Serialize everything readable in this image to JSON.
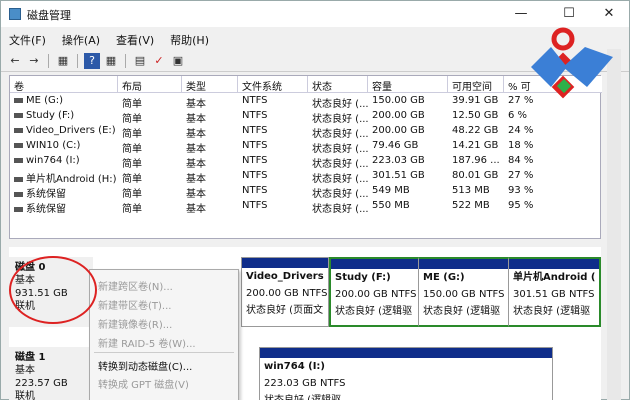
{
  "window": {
    "title": "磁盘管理",
    "buttons": [
      "—",
      "☐",
      "✕"
    ]
  },
  "menu": [
    "文件(F)",
    "操作(A)",
    "查看(V)",
    "帮助(H)"
  ],
  "toolbar": [
    "←",
    "→",
    "▦",
    "?",
    "▦",
    "▤",
    "✓",
    "▣"
  ],
  "table": {
    "columns": [
      "卷",
      "布局",
      "类型",
      "文件系统",
      "状态",
      "容量",
      "可用空间",
      "% 可"
    ],
    "rows": [
      [
        "ME (G:)",
        "简单",
        "基本",
        "NTFS",
        "状态良好 (...",
        "150.00 GB",
        "39.91 GB",
        "27 %"
      ],
      [
        "Study (F:)",
        "简单",
        "基本",
        "NTFS",
        "状态良好 (...",
        "200.00 GB",
        "12.50 GB",
        "6 %"
      ],
      [
        "Video_Drivers (E:)",
        "简单",
        "基本",
        "NTFS",
        "状态良好 (...",
        "200.00 GB",
        "48.22 GB",
        "24 %"
      ],
      [
        "WIN10 (C:)",
        "简单",
        "基本",
        "NTFS",
        "状态良好 (...",
        "79.46 GB",
        "14.21 GB",
        "18 %"
      ],
      [
        "win764 (I:)",
        "简单",
        "基本",
        "NTFS",
        "状态良好 (...",
        "223.03 GB",
        "187.96 ...",
        "84 %"
      ],
      [
        "单片机Android (H:)",
        "简单",
        "基本",
        "NTFS",
        "状态良好 (...",
        "301.51 GB",
        "80.01 GB",
        "27 %"
      ],
      [
        "系统保留",
        "简单",
        "基本",
        "NTFS",
        "状态良好 (...",
        "549 MB",
        "513 MB",
        "93 %"
      ],
      [
        "系统保留",
        "简单",
        "基本",
        "NTFS",
        "状态良好 (...",
        "550 MB",
        "522 MB",
        "95 %"
      ]
    ]
  },
  "disks": [
    {
      "name": "磁盘 0",
      "type": "基本",
      "size": "931.51 GB",
      "status": "联机"
    },
    {
      "name": "磁盘 1",
      "type": "基本",
      "size": "223.57 GB",
      "status": "联机"
    }
  ],
  "partitions": {
    "video": {
      "name": "Video_Drivers (",
      "size": "200.00 GB NTFS",
      "status": "状态良好 (页面文"
    },
    "study": {
      "name": "Study  (F:)",
      "size": "200.00 GB NTFS",
      "status": "状态良好 (逻辑驱"
    },
    "me": {
      "name": "ME  (G:)",
      "size": "150.00 GB NTFS",
      "status": "状态良好 (逻辑驱"
    },
    "android": {
      "name": "单片机Android (",
      "size": "301.51 GB NTFS",
      "status": "状态良好 (逻辑驱"
    },
    "win764": {
      "name": "win764  (I:)",
      "size": "223.03 GB NTFS",
      "status": "状态良好 (逻辑驱"
    }
  },
  "context_menu": {
    "items": [
      {
        "label": "新建跨区卷(N)...",
        "enabled": false
      },
      {
        "label": "新建带区卷(T)...",
        "enabled": false
      },
      {
        "label": "新建镜像卷(R)...",
        "enabled": false
      },
      {
        "label": "新建 RAID-5 卷(W)...",
        "enabled": false
      },
      {
        "label": "转换到动态磁盘(C)...",
        "enabled": true
      },
      {
        "label": "转换成 GPT 磁盘(V)",
        "enabled": false
      }
    ]
  },
  "colors": {
    "partition_bar": "#0f2d8a",
    "selected_border": "#2a8a2a",
    "annotation": "#dd2222"
  }
}
